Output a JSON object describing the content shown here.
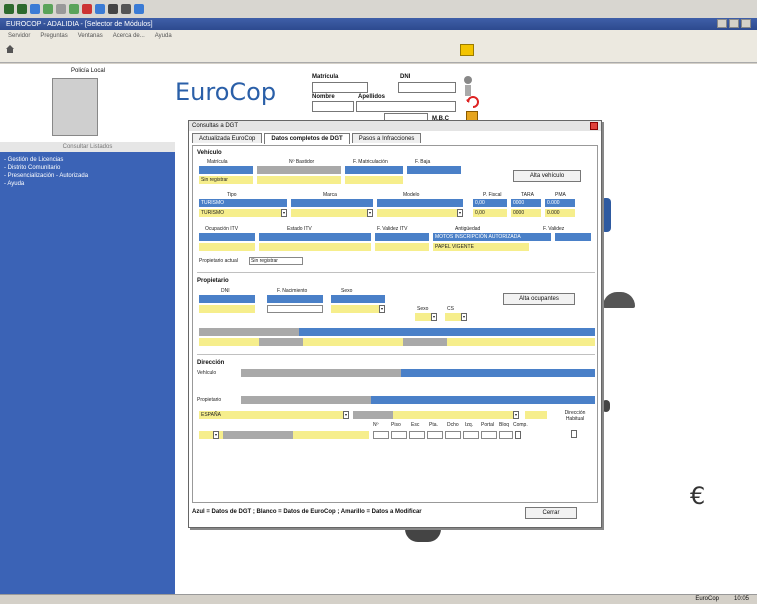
{
  "window": {
    "title": "EUROCOP - ADALIDIA - [Selector de Módulos]"
  },
  "menubar": [
    "Servidor",
    "Preguntas",
    "Ventanas",
    "Acerca de...",
    "Ayuda"
  ],
  "left_panel": {
    "photo_label": "Policía Local",
    "section_label": "Consultar Listados",
    "nav_items": [
      "- Gestión de Licencias",
      "- Distrito Comunitario",
      "- Presencialización - Autorizada",
      "- Ayuda"
    ]
  },
  "header": {
    "logo": "EuroCop",
    "matricula_label": "Matrícula",
    "dni_label": "DNI",
    "nombre_label": "Nombre",
    "apellidos_label": "Apellidos",
    "mbc_label": "M.B.C"
  },
  "dialog": {
    "title": "Consultas a DGT",
    "tabs": [
      "Actualizada EuroCop",
      "Datos completos de DGT",
      "Pasos a Infracciones"
    ],
    "vehiculo": {
      "title": "Vehículo",
      "labels": [
        "Matrícula",
        "Nº Bastidor",
        "F. Matriculación",
        "F. Baja"
      ],
      "sin_registrar": "Sin registrar",
      "add_button": "Alta vehículo",
      "labels2": [
        "Tipo",
        "Marca",
        "Modelo",
        "P. Fiscal",
        "TARA",
        "PMA"
      ],
      "tipo": "TURISMO",
      "tipo2": "TURISMO",
      "nums": [
        "0,00",
        "0000",
        "0.000"
      ],
      "nums2": [
        "0,00",
        "0000",
        "0.000"
      ],
      "labels3": [
        "Ocupación ITV",
        "Estado ITV",
        "F. Validez ITV",
        "Antigüedad",
        "F. Validez"
      ],
      "antiguedad": "MOTOS INSCRIPCIÓN AUTORIZADA",
      "antiguedad2": "PAPEL VIGENTE",
      "propietario_label": "Propietario actual",
      "propietario_value": "Sin registrar"
    },
    "propietario": {
      "title": "Propietario",
      "labels": [
        "DNI",
        "F. Nacimiento",
        "Sexo",
        "Sexo",
        "CS"
      ],
      "add_button": "Alta ocupantes"
    },
    "direccion": {
      "title": "Dirección",
      "vehiculo_label": "Vehículo",
      "propietario_label": "Propietario",
      "provincia": "ESPAÑA",
      "cols": [
        "Nº",
        "Piso",
        "Esc",
        "Pta.",
        "Dcho",
        "Izq.",
        "Portal",
        "Bloq",
        "Comp."
      ],
      "direccion_label": "Dirección Habitual"
    },
    "footer": "Azul = Datos de DGT ; Blanco = Datos de EuroCop ; Amarillo = Datos a Modificar",
    "cerrar": "Cerrar"
  },
  "status": {
    "left": "EuroCop",
    "right": "10:05"
  },
  "colors": {
    "dgt_blue": "#4a80c8",
    "modify_yellow": "#f6ee8c",
    "eurocop_white": "#ffffff",
    "panel_blue": "#3b63b6"
  }
}
